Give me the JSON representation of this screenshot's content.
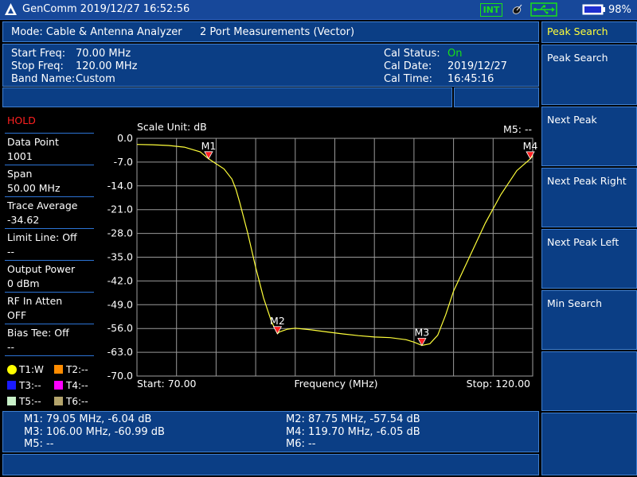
{
  "status_bar": {
    "title": "GenComm 2019/12/27 16:52:56",
    "int_label": "INT",
    "battery": "98%"
  },
  "header": {
    "mode": "Mode: Cable & Antenna Analyzer",
    "measurement": "2 Port Measurements (Vector)"
  },
  "freq_info": {
    "start_label": "Start Freq:",
    "start_value": "70.00 MHz",
    "stop_label": "Stop Freq:",
    "stop_value": "120.00 MHz",
    "band_label": "Band Name:",
    "band_value": "Custom"
  },
  "cal_info": {
    "status_label": "Cal Status:",
    "status_value": "On",
    "date_label": "Cal Date:",
    "date_value": "2019/12/27",
    "time_label": "Cal Time:",
    "time_value": "16:45:16"
  },
  "left_panel": {
    "hold": "HOLD",
    "data_point_label": "Data Point",
    "data_point_value": "1001",
    "span_label": "Span",
    "span_value": "50.00 MHz",
    "trace_avg_label": "Trace Average",
    "trace_avg_value": "-34.62",
    "limit_line_label": "Limit Line: Off",
    "limit_line_value": "--",
    "output_power_label": "Output Power",
    "output_power_value": "0 dBm",
    "rf_atten_label": "RF In Atten",
    "rf_atten_value": "OFF",
    "bias_tee_label": "Bias Tee: Off",
    "bias_tee_value": "--",
    "legend": [
      {
        "label": "T1:W",
        "color": "#ffff00"
      },
      {
        "label": "T2:--",
        "color": "#ff8c00"
      },
      {
        "label": "T3:--",
        "color": "#1a1aff"
      },
      {
        "label": "T4:--",
        "color": "#ff00ff"
      },
      {
        "label": "T5:--",
        "color": "#c8f0c8"
      },
      {
        "label": "T6:--",
        "color": "#b4a46c"
      }
    ]
  },
  "chart_data": {
    "type": "line",
    "scale_unit": "Scale Unit: dB",
    "m5_readout": "M5: --",
    "xlabel": "Frequency (MHz)",
    "start_label": "Start: 70.00",
    "stop_label": "Stop: 120.00",
    "x_range": [
      70,
      120
    ],
    "ylim": [
      -70,
      0
    ],
    "y_ticks": [
      "0.0",
      "-7.0",
      "-14.0",
      "-21.0",
      "-28.0",
      "-35.0",
      "-42.0",
      "-49.0",
      "-56.0",
      "-63.0",
      "-70.0"
    ],
    "trace_color": "#ffff3a",
    "series": [
      {
        "name": "T1",
        "x": [
          70,
          72,
          74,
          76,
          78,
          79.05,
          80,
          81,
          82,
          82.5,
          83,
          84,
          85,
          86,
          87,
          87.75,
          88,
          89,
          90,
          92,
          94,
          96,
          98,
          100,
          102,
          104,
          105,
          106,
          107,
          108,
          109,
          110,
          112,
          114,
          116,
          118,
          119.7,
          120
        ],
        "y": [
          -1.8,
          -1.9,
          -2.1,
          -2.6,
          -4.0,
          -6.04,
          -7.5,
          -9.0,
          -12.0,
          -15.0,
          -19.0,
          -28.0,
          -38.0,
          -47.0,
          -54.0,
          -57.54,
          -57.0,
          -56.2,
          -55.9,
          -56.4,
          -57.0,
          -57.6,
          -58.1,
          -58.5,
          -58.7,
          -59.3,
          -60.0,
          -60.99,
          -60.5,
          -58.0,
          -52.0,
          -45.0,
          -35.0,
          -25.0,
          -16.5,
          -9.5,
          -6.05,
          -5.2
        ]
      }
    ],
    "markers": [
      {
        "label": "M1",
        "x": 79.05,
        "y": -6.04
      },
      {
        "label": "M2",
        "x": 87.75,
        "y": -57.54
      },
      {
        "label": "M3",
        "x": 106.0,
        "y": -60.99
      },
      {
        "label": "M4",
        "x": 119.7,
        "y": -6.05
      }
    ]
  },
  "marker_table": {
    "m1": "M1: 79.05 MHz, -6.04 dB",
    "m2": "M2: 87.75 MHz, -57.54 dB",
    "m3": "M3: 106.00 MHz, -60.99 dB",
    "m4": "M4: 119.70 MHz, -6.05 dB",
    "m5": "M5: --",
    "m6": "M6: --"
  },
  "softkeys": {
    "title": "Peak Search",
    "items": [
      "Peak Search",
      "Next Peak",
      "Next Peak Right",
      "Next Peak Left",
      "Min Search",
      "",
      ""
    ]
  }
}
